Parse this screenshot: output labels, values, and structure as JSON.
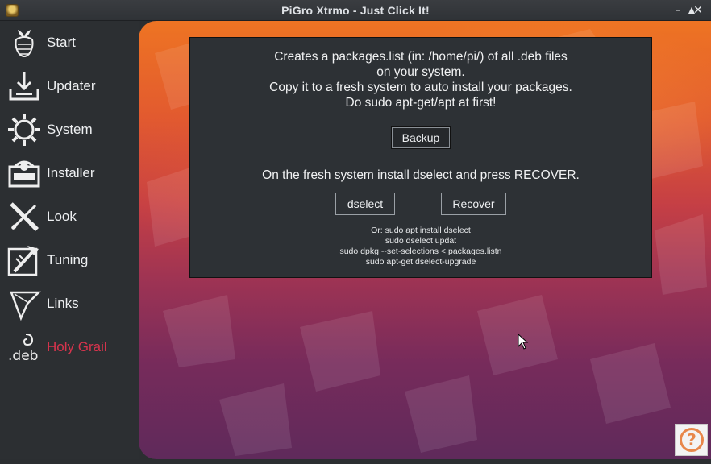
{
  "window": {
    "title": "PiGro Xtrmo - Just Click It!",
    "minimize": "–",
    "maximize": "▲",
    "close": "✕"
  },
  "sidebar": {
    "items": [
      {
        "label": "Start",
        "icon": "raspberry-icon"
      },
      {
        "label": "Updater",
        "icon": "download-tray-icon"
      },
      {
        "label": "System",
        "icon": "gear-icon"
      },
      {
        "label": "Installer",
        "icon": "package-box-icon"
      },
      {
        "label": "Look",
        "icon": "brush-ruler-icon"
      },
      {
        "label": "Tuning",
        "icon": "hammer-ruler-icon"
      },
      {
        "label": "Links",
        "icon": "funnel-icon"
      },
      {
        "label": "Holy Grail",
        "icon": "deb-icon",
        "active": true
      }
    ]
  },
  "panel": {
    "description": [
      "Creates a packages.list (in: /home/pi/) of all .deb files",
      "on your system.",
      "Copy it to a fresh system to auto install your packages.",
      "Do sudo apt-get/apt at first!"
    ],
    "backup_label": "Backup",
    "recover_text": "On the  fresh system install dselect and press RECOVER.",
    "dselect_label": "dselect",
    "recover_label": "Recover",
    "commands": [
      "Or: sudo apt install dselect",
      "sudo dselect updat",
      "sudo dpkg --set-selections < packages.listn",
      "sudo apt-get dselect-upgrade"
    ]
  },
  "help": {
    "label": "?"
  },
  "colors": {
    "active": "#d7344d",
    "panel": "#2d3135",
    "sidebar": "#2c2f32"
  },
  "deb_icon_text": ".deb"
}
